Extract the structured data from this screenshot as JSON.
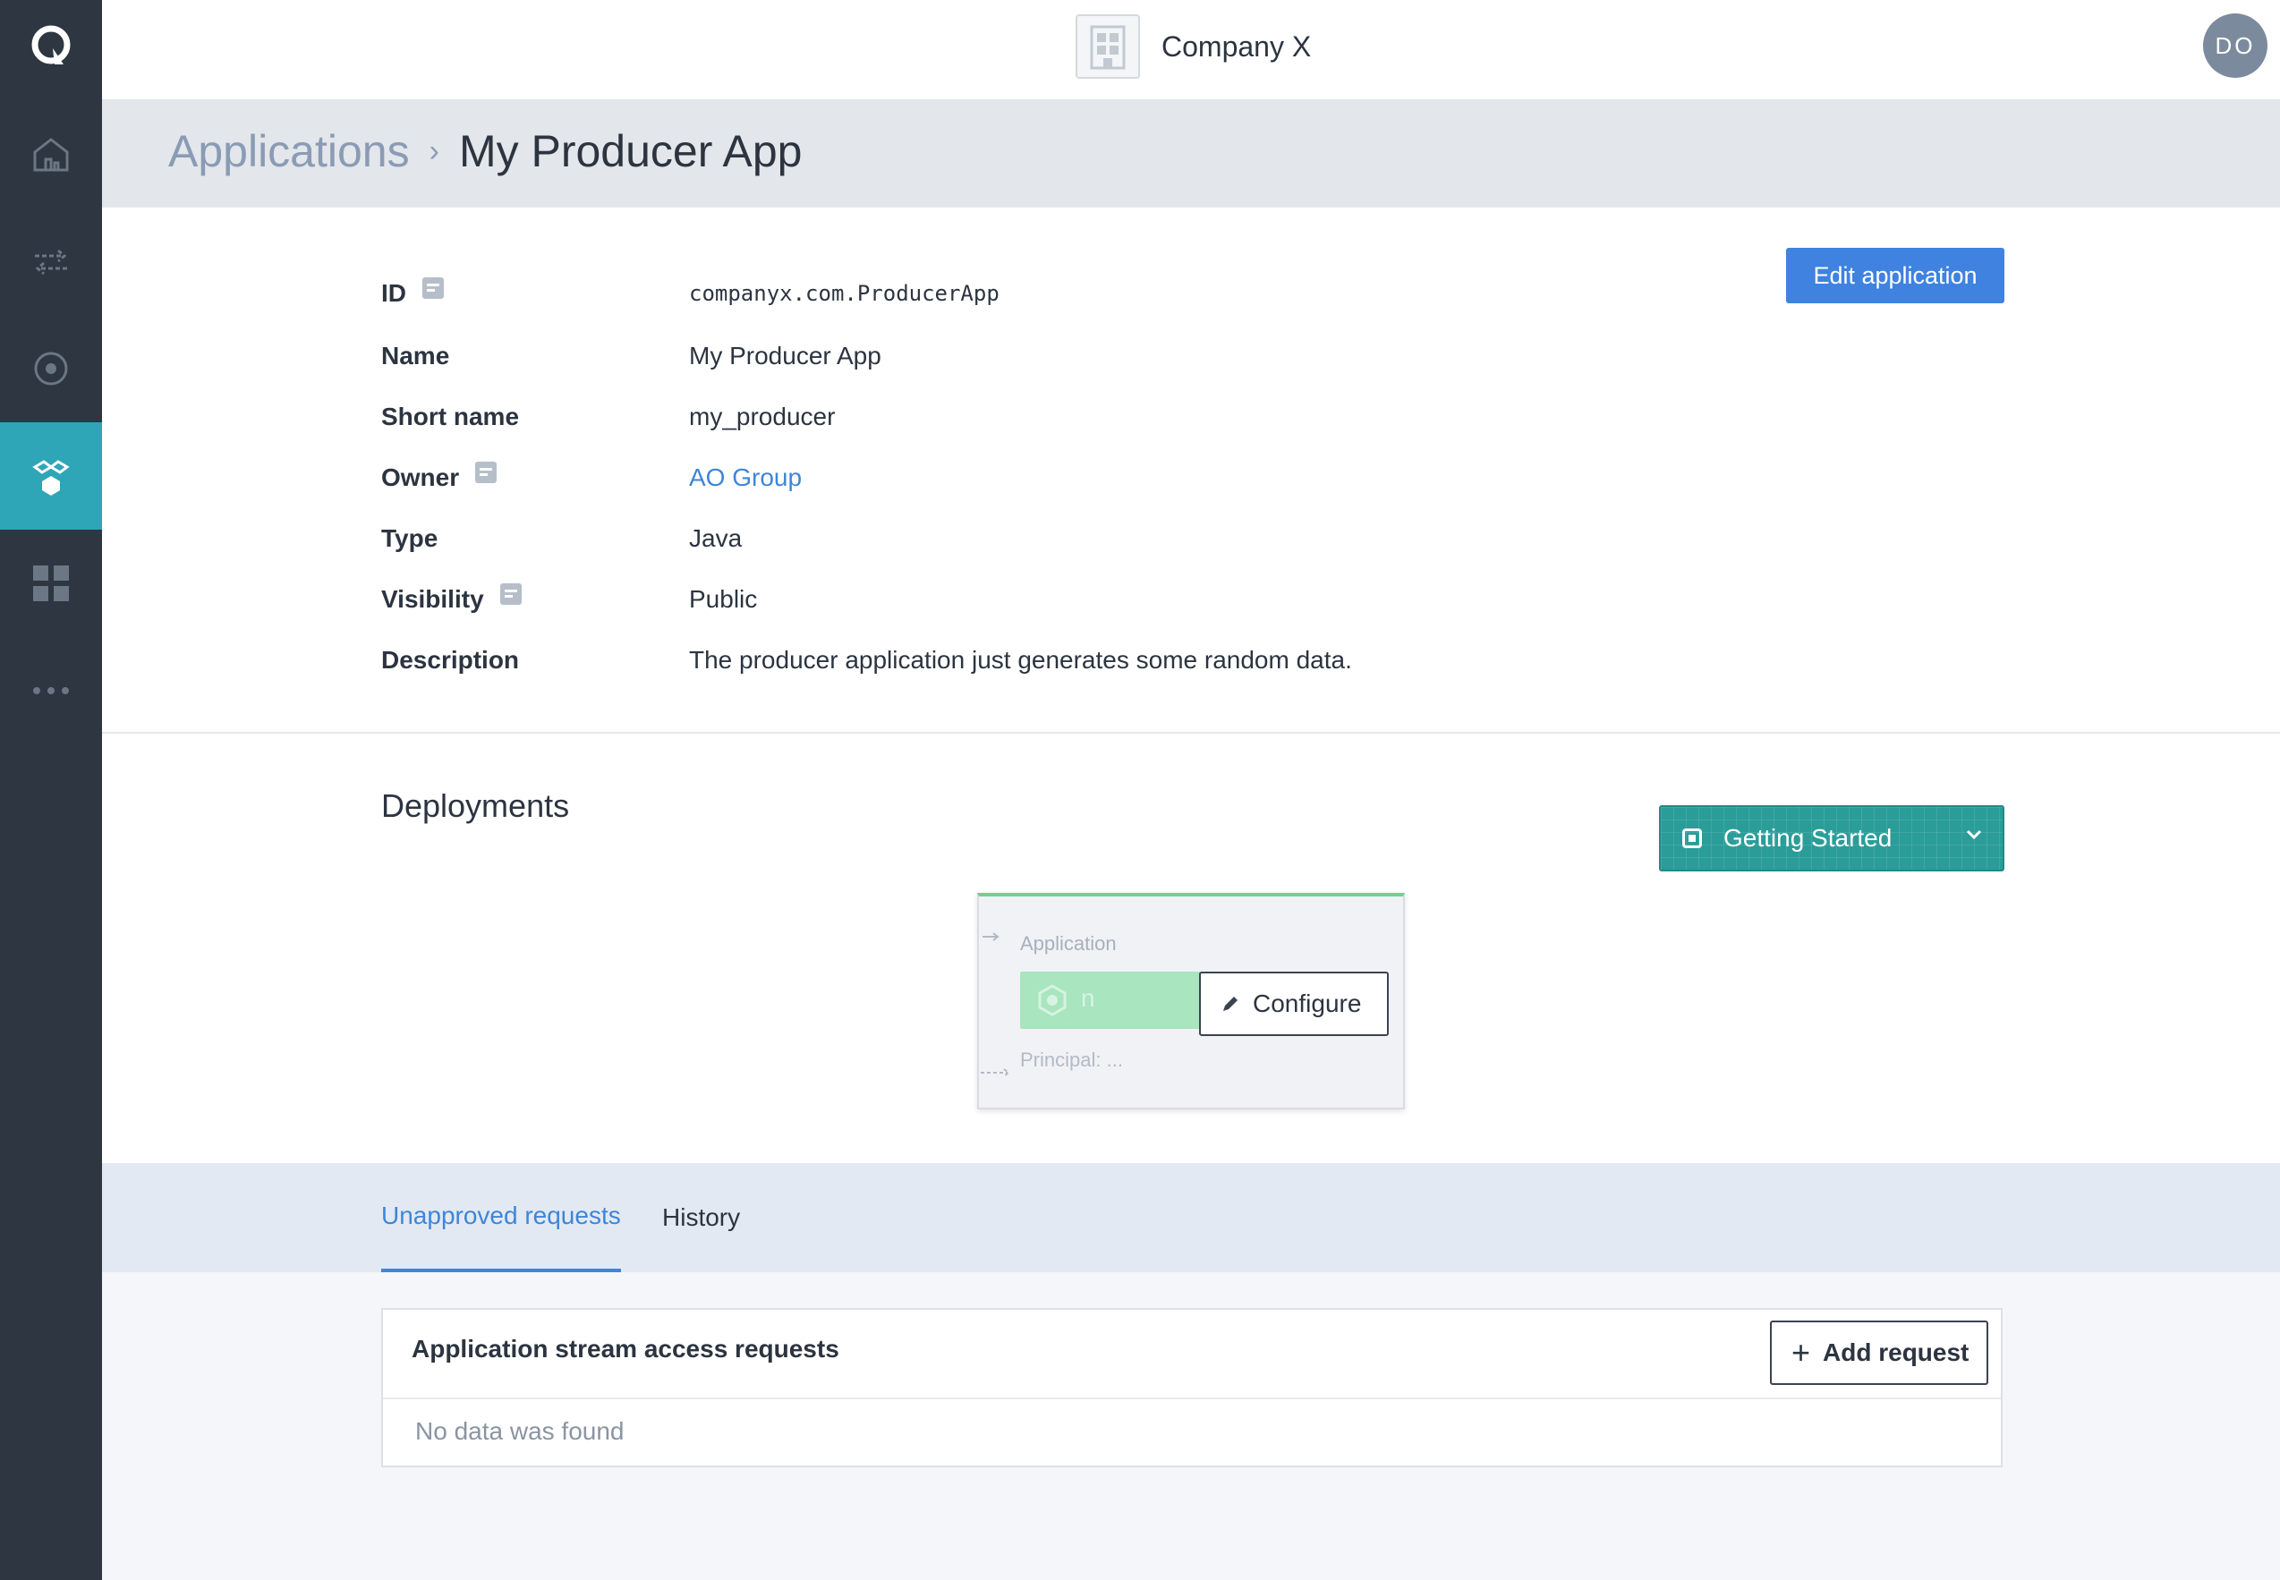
{
  "nav": {
    "items": [
      {
        "name": "home",
        "icon": "home-icon"
      },
      {
        "name": "streams",
        "icon": "transfer-arrows-icon"
      },
      {
        "name": "monitor",
        "icon": "target-icon"
      },
      {
        "name": "applications",
        "icon": "applications-icon",
        "active": true
      },
      {
        "name": "dashboard",
        "icon": "grid-icon"
      },
      {
        "name": "more",
        "icon": "more-dots-icon"
      }
    ]
  },
  "topbar": {
    "company_name": "Company X",
    "avatar_initials": "DO"
  },
  "breadcrumb": {
    "parent": "Applications",
    "separator": "›",
    "current": "My Producer App"
  },
  "details": {
    "edit_label": "Edit application",
    "rows": [
      {
        "label": "ID",
        "value": "companyx.com.ProducerApp"
      },
      {
        "label": "Name",
        "value": "My Producer App"
      },
      {
        "label": "Short name",
        "value": "my_producer"
      },
      {
        "label": "Owner",
        "value": "AO Group"
      },
      {
        "label": "Type",
        "value": "Java"
      },
      {
        "label": "Visibility",
        "value": "Public"
      },
      {
        "label": "Description",
        "value": "The producer application just generates some random data."
      }
    ]
  },
  "deployments": {
    "title": "Deployments",
    "getting_started_label": "Getting Started",
    "card": {
      "title": "Application",
      "bar_text": "n",
      "subtitle": "Principal: ..."
    },
    "configure_label": "Configure"
  },
  "tabs": [
    {
      "label": "Unapproved requests",
      "active": true
    },
    {
      "label": "History",
      "active": false
    }
  ],
  "requests": {
    "title": "Application stream access requests",
    "add_label": "Add request",
    "empty_text": "No data was found"
  },
  "colors": {
    "sidebar": "#2d3641",
    "active_nav": "#2ea6b8",
    "primary": "#3f82e0",
    "link": "#3d86d8",
    "teal": "#2a9d99",
    "green": "#6cd38f"
  }
}
